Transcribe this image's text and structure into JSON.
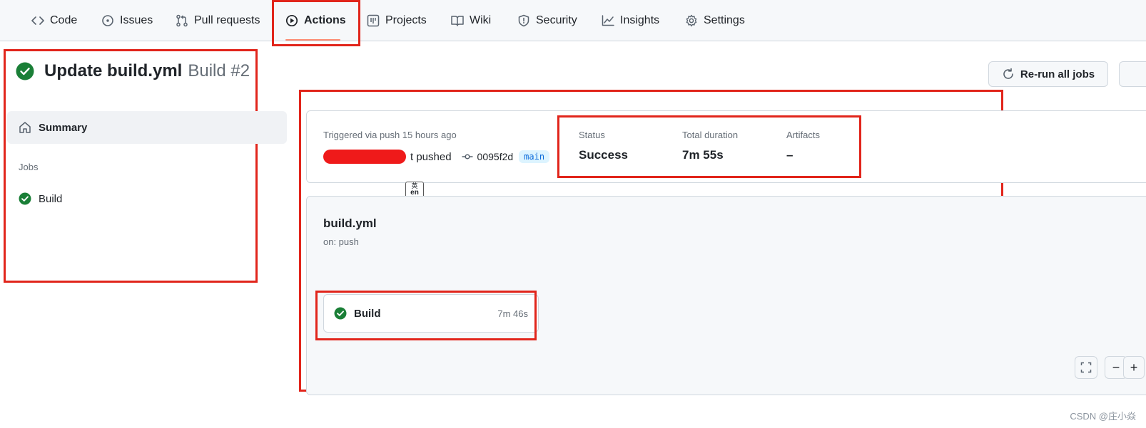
{
  "nav": {
    "tabs": [
      {
        "label": "Code",
        "icon": "code-icon"
      },
      {
        "label": "Issues",
        "icon": "issue-icon"
      },
      {
        "label": "Pull requests",
        "icon": "pull-request-icon"
      },
      {
        "label": "Actions",
        "icon": "play-icon",
        "active": true
      },
      {
        "label": "Projects",
        "icon": "project-icon"
      },
      {
        "label": "Wiki",
        "icon": "book-icon"
      },
      {
        "label": "Security",
        "icon": "shield-icon"
      },
      {
        "label": "Insights",
        "icon": "graph-icon"
      },
      {
        "label": "Settings",
        "icon": "gear-icon"
      }
    ]
  },
  "run": {
    "title": "Update build.yml",
    "build_label": "Build #2",
    "status_icon": "check-circle-icon"
  },
  "sidebar": {
    "summary_label": "Summary",
    "jobs_heading": "Jobs",
    "jobs": [
      {
        "label": "Build",
        "status": "success"
      }
    ]
  },
  "actions": {
    "rerun_label": "Re-run all jobs"
  },
  "summary": {
    "trigger": "Triggered via push 15 hours ago",
    "pushed_suffix": "t pushed",
    "commit": "0095f2d",
    "branch": "main",
    "status_label": "Status",
    "status_value": "Success",
    "duration_label": "Total duration",
    "duration_value": "7m 55s",
    "artifacts_label": "Artifacts",
    "artifacts_value": "–"
  },
  "ime": {
    "top": "英",
    "bottom": "en"
  },
  "workflow": {
    "name": "build.yml",
    "on": "on: push",
    "job": {
      "name": "Build",
      "duration": "7m 46s"
    }
  },
  "graph_controls": {
    "zoom_out": "−",
    "zoom_in": "+"
  },
  "watermark": "CSDN @庄小焱",
  "colors": {
    "success": "#1a7f37",
    "annotation_red": "#e1251b",
    "active_tab_underline": "#fd8c73",
    "branch_bg": "#ddf4ff",
    "branch_text": "#0969da"
  }
}
